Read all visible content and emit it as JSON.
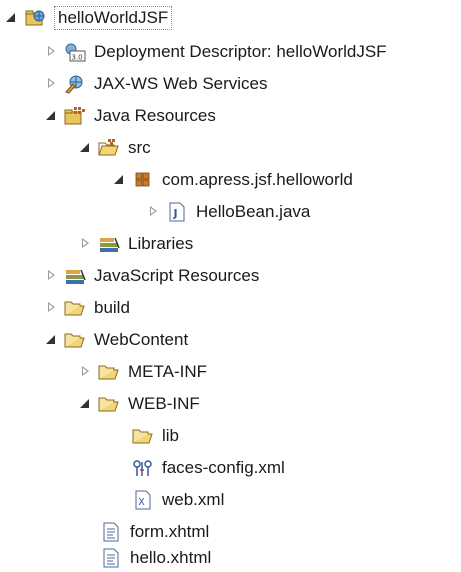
{
  "tree": {
    "nodes": [
      {
        "label": "helloWorldJSF",
        "icon": "web-project-icon",
        "expanded": true,
        "selected": true
      },
      {
        "label": "Deployment Descriptor: helloWorldJSF",
        "icon": "deployment-descriptor-icon",
        "expanded": false
      },
      {
        "label": "JAX-WS Web Services",
        "icon": "web-services-icon",
        "expanded": false
      },
      {
        "label": "Java Resources",
        "icon": "java-resources-icon",
        "expanded": true
      },
      {
        "label": "src",
        "icon": "source-folder-icon",
        "expanded": true
      },
      {
        "label": "com.apress.jsf.helloworld",
        "icon": "package-icon",
        "expanded": true
      },
      {
        "label": "HelloBean.java",
        "icon": "java-file-icon",
        "expanded": false
      },
      {
        "label": "Libraries",
        "icon": "libraries-icon",
        "expanded": false
      },
      {
        "label": "JavaScript Resources",
        "icon": "libraries-icon",
        "expanded": false
      },
      {
        "label": "build",
        "icon": "folder-icon",
        "expanded": false
      },
      {
        "label": "WebContent",
        "icon": "folder-open-icon",
        "expanded": true
      },
      {
        "label": "META-INF",
        "icon": "folder-icon",
        "expanded": false
      },
      {
        "label": "WEB-INF",
        "icon": "folder-open-icon",
        "expanded": true
      },
      {
        "label": "lib",
        "icon": "folder-icon"
      },
      {
        "label": "faces-config.xml",
        "icon": "faces-config-icon"
      },
      {
        "label": "web.xml",
        "icon": "xml-file-icon"
      },
      {
        "label": "form.xhtml",
        "icon": "xhtml-file-icon"
      },
      {
        "label": "hello.xhtml",
        "icon": "xhtml-file-icon"
      }
    ]
  }
}
